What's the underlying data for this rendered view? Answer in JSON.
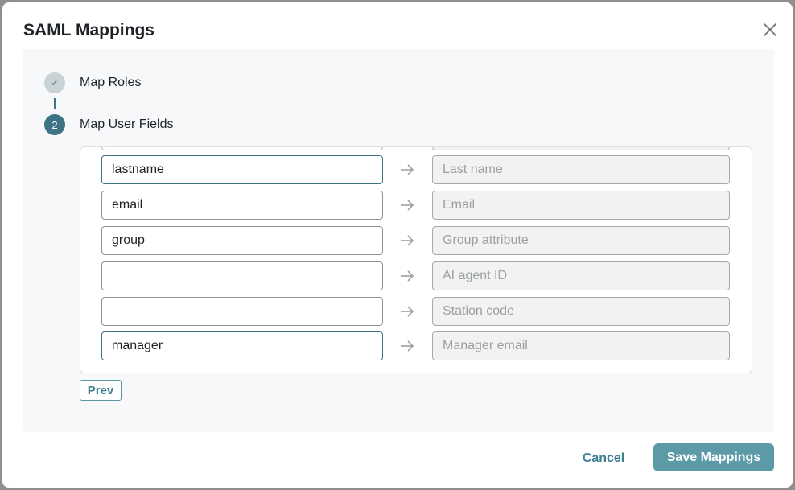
{
  "dialog": {
    "title": "SAML Mappings"
  },
  "stepper": {
    "steps": [
      {
        "label": "Map Roles",
        "marker": "✓",
        "status": "completed"
      },
      {
        "label": "Map User Fields",
        "marker": "2",
        "status": "current"
      }
    ]
  },
  "mappings": [
    {
      "source_value": "lastname",
      "target_placeholder": "Last name"
    },
    {
      "source_value": "email",
      "target_placeholder": "Email"
    },
    {
      "source_value": "group",
      "target_placeholder": "Group attribute"
    },
    {
      "source_value": "",
      "target_placeholder": "AI agent ID"
    },
    {
      "source_value": "",
      "target_placeholder": "Station code"
    },
    {
      "source_value": "manager",
      "target_placeholder": "Manager email"
    }
  ],
  "buttons": {
    "prev": "Prev",
    "cancel": "Cancel",
    "save": "Save Mappings"
  },
  "colors": {
    "accent": "#3d7384",
    "primary_button": "#5b9aa6",
    "completed_step": "#c9d3d6"
  }
}
